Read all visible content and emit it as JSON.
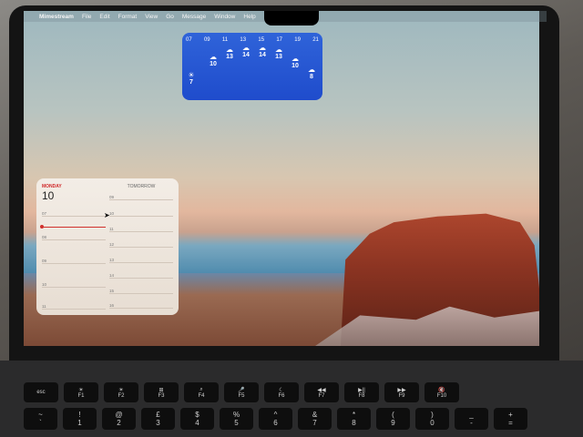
{
  "menubar": {
    "app": "Mimestream",
    "items": [
      "File",
      "Edit",
      "Format",
      "View",
      "Go",
      "Message",
      "Window",
      "Help"
    ]
  },
  "weather": {
    "hours": [
      "07",
      "09",
      "11",
      "13",
      "15",
      "17",
      "19",
      "21"
    ],
    "temps": [
      {
        "icon": "partly-sunny-icon",
        "value": "7"
      },
      {
        "icon": "cloud-icon",
        "value": "10"
      },
      {
        "icon": "cloud-rain-icon",
        "value": "13"
      },
      {
        "icon": "cloud-rain-icon",
        "value": "14"
      },
      {
        "icon": "cloud-rain-icon",
        "value": "14"
      },
      {
        "icon": "cloud-rain-icon",
        "value": "13"
      },
      {
        "icon": "cloud-icon",
        "value": "10"
      },
      {
        "icon": "cloud-icon",
        "value": "8"
      }
    ]
  },
  "calendar": {
    "day": "MONDAY",
    "date": "10",
    "tomorrow_label": "TOMORROW",
    "today_hours": [
      "07",
      "08",
      "09",
      "10",
      "11"
    ],
    "tomorrow_hours": [
      "09",
      "10",
      "11",
      "12",
      "13",
      "14",
      "15",
      "16"
    ]
  },
  "keyboard": {
    "fn_row": [
      "esc",
      "F1",
      "F2",
      "F3",
      "F4",
      "F5",
      "F6",
      "F7",
      "F8",
      "F9",
      "F10"
    ],
    "fn_icons": [
      "",
      "☀",
      "☀",
      "⊞",
      "⌕",
      "🎤",
      "☾",
      "◀◀",
      "▶||",
      "▶▶",
      "🔇"
    ],
    "num_row": [
      "~",
      "!",
      "@",
      "£",
      "$",
      "%",
      "^",
      "&",
      "*",
      "(",
      ")",
      "_",
      "+"
    ],
    "num_row_bottom": [
      "`",
      "1",
      "2",
      "3",
      "4",
      "5",
      "6",
      "7",
      "8",
      "9",
      "0",
      "-",
      "="
    ]
  },
  "colors": {
    "weather_bg": "#2f63d9",
    "calendar_accent": "#d0312d"
  }
}
